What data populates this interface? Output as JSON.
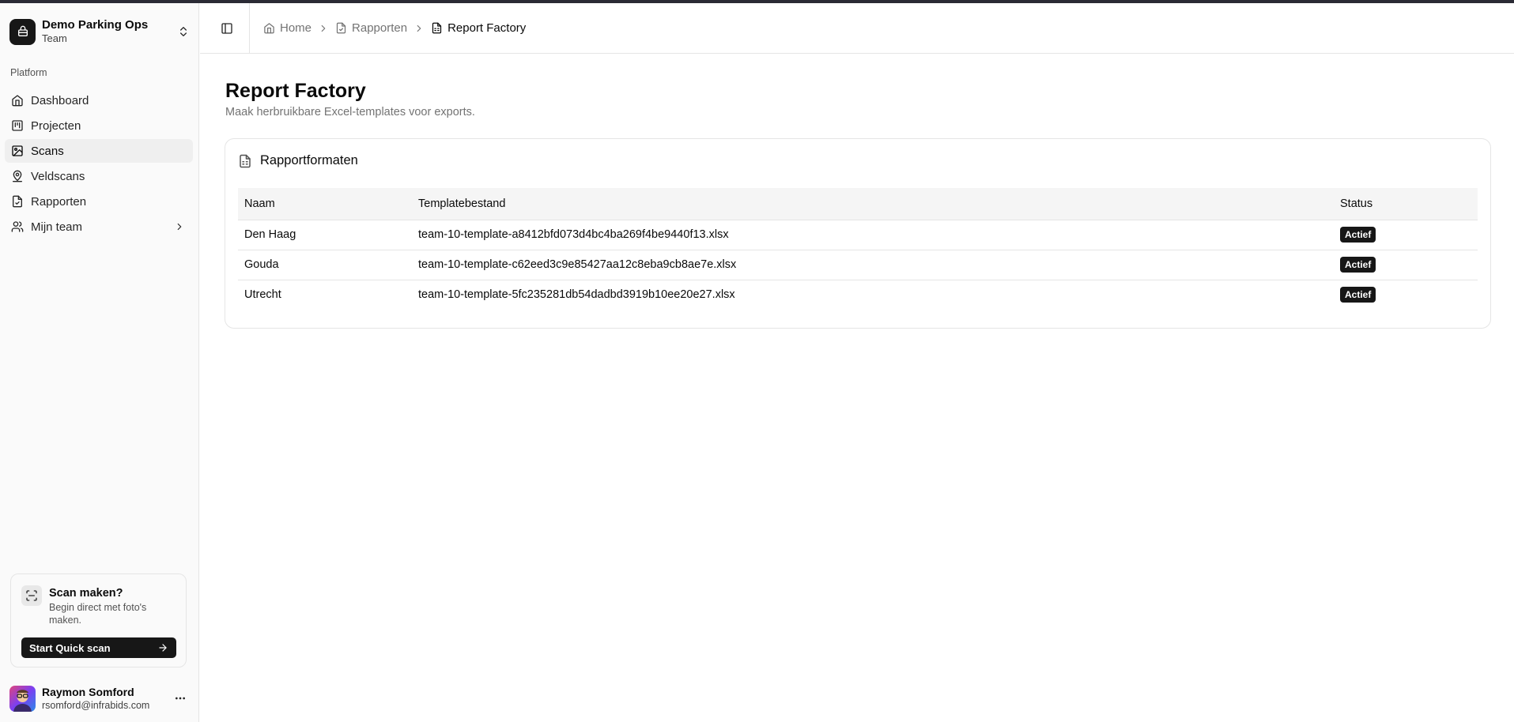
{
  "sidebar": {
    "team": {
      "name": "Demo Parking Ops",
      "plan": "Team"
    },
    "group_label": "Platform",
    "items": [
      {
        "label": "Dashboard",
        "icon": "home-icon",
        "active": false
      },
      {
        "label": "Projecten",
        "icon": "kanban-icon",
        "active": false
      },
      {
        "label": "Scans",
        "icon": "images-icon",
        "active": true
      },
      {
        "label": "Veldscans",
        "icon": "map-pin-user-icon",
        "active": false
      },
      {
        "label": "Rapporten",
        "icon": "file-check-icon",
        "active": false
      },
      {
        "label": "Mijn team",
        "icon": "users-icon",
        "active": false
      }
    ],
    "promo": {
      "title": "Scan maken?",
      "description": "Begin direct met foto's maken.",
      "button_label": "Start Quick scan"
    },
    "user": {
      "name": "Raymon Somford",
      "email": "rsomford@infrabids.com"
    }
  },
  "header": {
    "breadcrumb": [
      {
        "label": "Home",
        "icon": "home-icon"
      },
      {
        "label": "Rapporten",
        "icon": "file-check-icon"
      },
      {
        "label": "Report Factory",
        "icon": "file-spreadsheet-icon"
      }
    ]
  },
  "main": {
    "title": "Report Factory",
    "subtitle": "Maak herbruikbare Excel-templates voor exports.",
    "card": {
      "title": "Rapportformaten",
      "columns": [
        "Naam",
        "Templatebestand",
        "Status"
      ],
      "rows": [
        {
          "name": "Den Haag",
          "file": "team-10-template-a8412bfd073d4bc4ba269f4be9440f13.xlsx",
          "status": "Actief"
        },
        {
          "name": "Gouda",
          "file": "team-10-template-c62eed3c9e85427aa12c8eba9cb8ae7e.xlsx",
          "status": "Actief"
        },
        {
          "name": "Utrecht",
          "file": "team-10-template-5fc235281db54dadbd3919b10ee20e27.xlsx",
          "status": "Actief"
        }
      ]
    }
  },
  "colors": {
    "primary": "#171717",
    "sidebar_bg": "#fafafa",
    "border": "#e5e5e5",
    "muted_text": "#737373"
  }
}
